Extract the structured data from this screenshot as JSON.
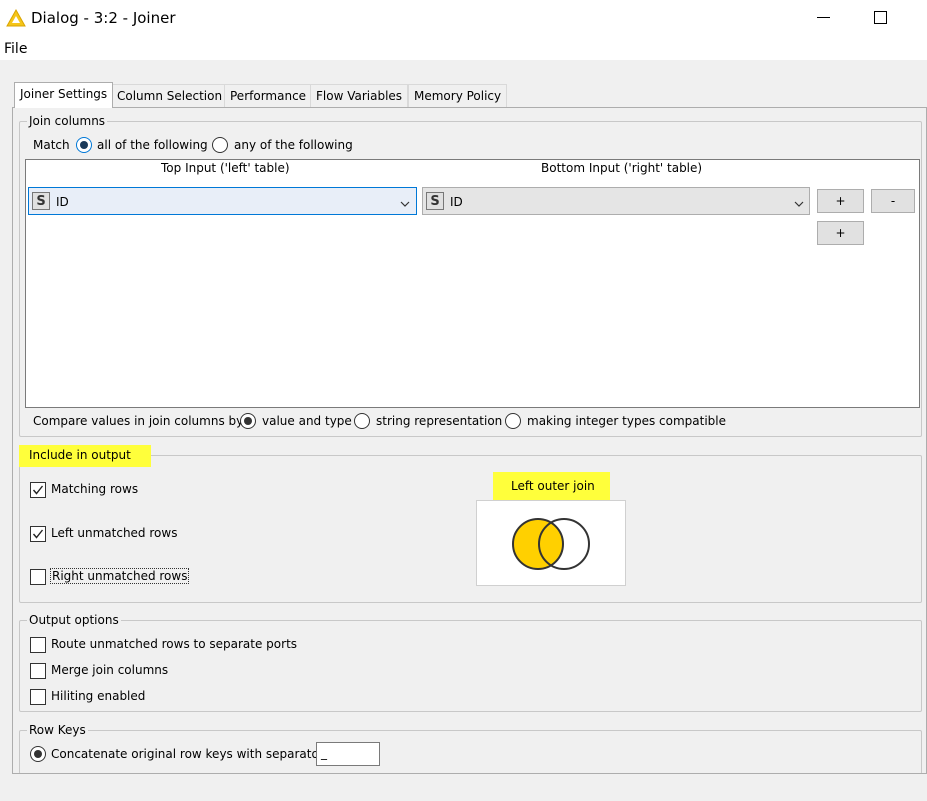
{
  "window": {
    "title": "Dialog - 3:2 - Joiner",
    "icon": "knime-triangle-icon"
  },
  "menu": {
    "file": "File"
  },
  "tabs": [
    {
      "label": "Joiner Settings",
      "active": true
    },
    {
      "label": "Column Selection"
    },
    {
      "label": "Performance"
    },
    {
      "label": "Flow Variables"
    },
    {
      "label": "Memory Policy"
    }
  ],
  "join_columns": {
    "title": "Join columns",
    "match_label": "Match",
    "match_all": "all of the following",
    "match_any": "any of the following",
    "top_header": "Top Input ('left' table)",
    "bottom_header": "Bottom Input ('right' table)",
    "left_value": "ID",
    "right_value": "ID",
    "type_badge": "S",
    "add_button": "+",
    "remove_button": "-",
    "compare_label": "Compare values in join columns by",
    "compare_value_type": "value and type",
    "compare_string": "string representation",
    "compare_integer": "making integer types compatible"
  },
  "include_output": {
    "title": "Include in output",
    "matching_rows": "Matching rows",
    "left_unmatched": "Left unmatched rows",
    "right_unmatched": "Right unmatched rows",
    "join_type": "Left outer join"
  },
  "output_options": {
    "title": "Output options",
    "route_unmatched": "Route unmatched rows to separate ports",
    "merge_columns": "Merge join columns",
    "hiliting": "Hiliting enabled"
  },
  "row_keys": {
    "title": "Row Keys",
    "concatenate": "Concatenate original row keys with separator",
    "separator": "_"
  },
  "colors": {
    "highlight": "#ffff3b",
    "venn_fill": "#ffd000"
  }
}
